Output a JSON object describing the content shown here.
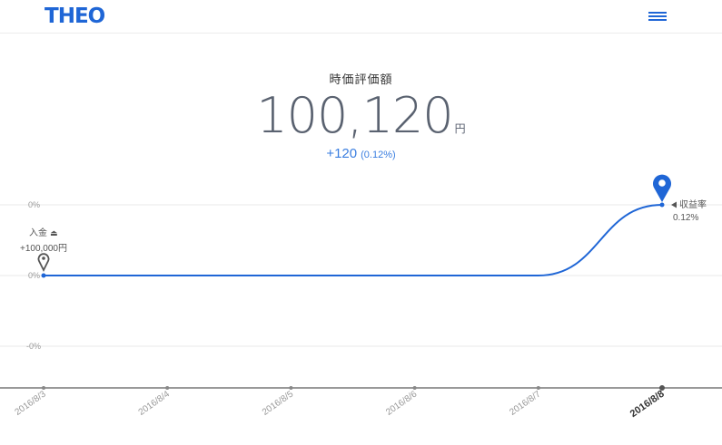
{
  "header": {
    "logo_text": "THEO",
    "menu_icon": "hamburger-menu-icon",
    "brand_color": "#1f66d6"
  },
  "summary": {
    "label": "時価評価額",
    "value": "100,120",
    "unit": "円",
    "gain": "+120",
    "gain_pct": "(0.12%)"
  },
  "chart_data": {
    "type": "line",
    "x": [
      "2016/8/3",
      "2016/8/4",
      "2016/8/5",
      "2016/8/6",
      "2016/8/7",
      "2016/8/8"
    ],
    "highlight_x": "2016/8/8",
    "y_ticks": [
      "0%",
      "0%",
      "-0%"
    ],
    "series": [
      {
        "values": [
          0,
          0,
          0,
          0,
          0,
          0.12
        ],
        "color": "#1f66d6"
      }
    ],
    "annotations": {
      "deposit": {
        "label": "入金",
        "amount": "+100,000円",
        "icon": "deposit-icon",
        "marker_icon": "map-pin-outline-icon"
      },
      "return_rate": {
        "label": "収益率",
        "value": "0.12%",
        "marker_icon": "map-pin-filled-icon"
      }
    },
    "grid": true
  }
}
